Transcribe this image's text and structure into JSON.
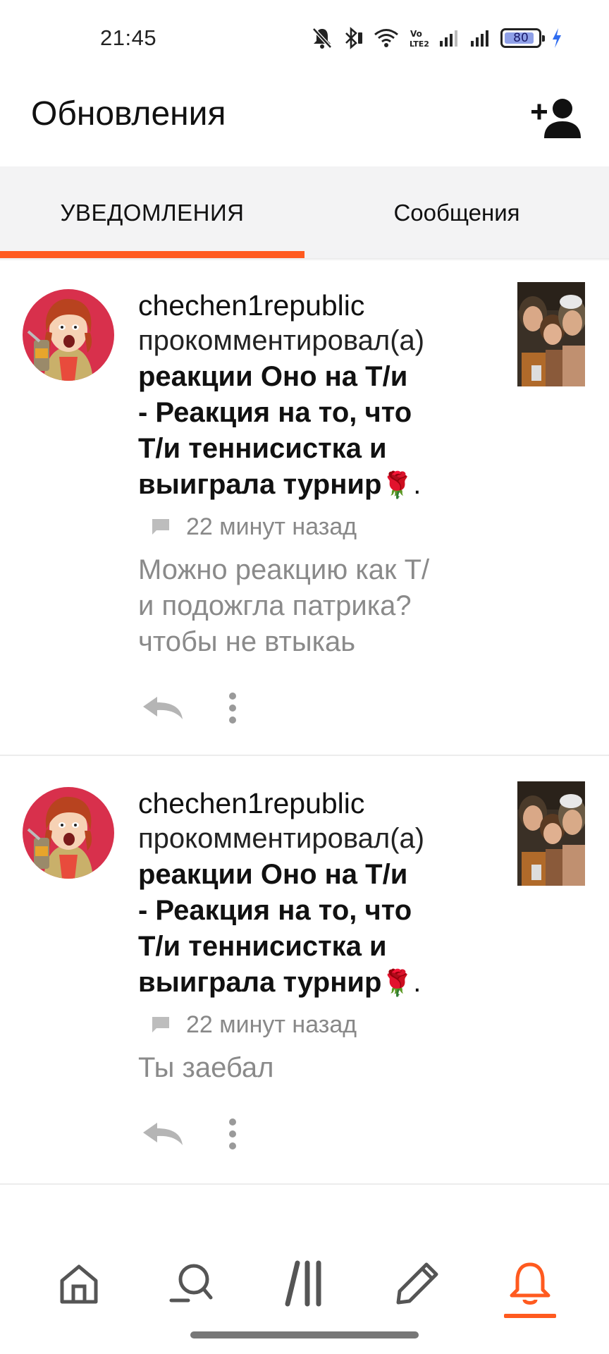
{
  "status_bar": {
    "time": "21:45",
    "battery": "80",
    "icons": [
      "mute-icon",
      "bluetooth-icon",
      "wifi-icon",
      "volte-icon",
      "signal-icon",
      "signal-icon",
      "battery-icon",
      "charging-icon"
    ]
  },
  "header": {
    "title": "Обновления",
    "add_friend_icon": "add-person-icon"
  },
  "tabs": [
    {
      "label": "УВЕДОМЛЕНИЯ",
      "active": true
    },
    {
      "label": "Сообщения",
      "active": false
    }
  ],
  "colors": {
    "accent": "#ff5a1f",
    "tab_bg": "#f3f3f4",
    "muted_text": "#8a8a8a"
  },
  "notifications": [
    {
      "username": "chechen1republic",
      "action": "прокомментировал(а)",
      "story_line1": "реакции Оно на Т/и",
      "story_line2": "- Реакция на то, что",
      "story_line3": "Т/и теннисистка и",
      "story_line4": "выиграла турнир",
      "rose": "🌹",
      "dot": ".",
      "time": "22 минут назад",
      "comment_line1": "Можно реакцию как Т/",
      "comment_line2": "и подожгла патрика?",
      "comment_line3": "чтобы не втыкаь"
    },
    {
      "username": "chechen1republic",
      "action": "прокомментировал(а)",
      "story_line1": "реакции Оно на Т/и",
      "story_line2": "- Реакция на то, что",
      "story_line3": "Т/и теннисистка и",
      "story_line4": "выиграла турнир",
      "rose": "🌹",
      "dot": ".",
      "time": "22 минут назад",
      "comment_line1": "Ты заебал"
    }
  ],
  "bottom_nav": [
    {
      "icon": "home-icon",
      "active": false
    },
    {
      "icon": "search-icon",
      "active": false
    },
    {
      "icon": "library-icon",
      "active": false
    },
    {
      "icon": "pencil-icon",
      "active": false
    },
    {
      "icon": "bell-icon",
      "active": true
    }
  ]
}
